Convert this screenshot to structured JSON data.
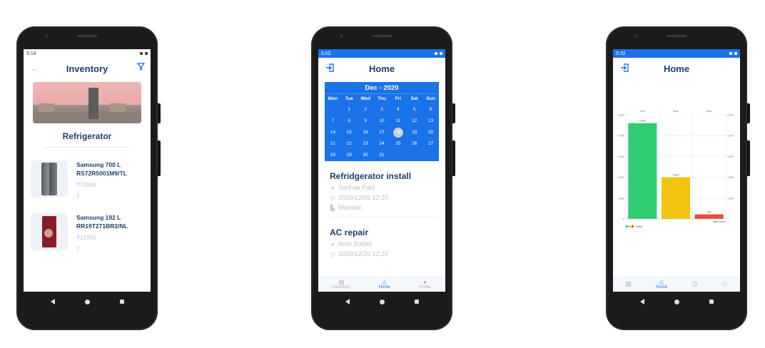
{
  "phones": [
    {
      "time": "9:18",
      "title": "Inventory",
      "category": "Refrigerator",
      "items": [
        {
          "name_line1": "Samsung 700 L",
          "name_line2": "RS72R5001M9/TL",
          "price": "₹74990",
          "qty": "1"
        },
        {
          "name_line1": "Samsung 192 L",
          "name_line2": "RR19T271BR2/NL",
          "price": "₹12990",
          "qty": "1"
        }
      ]
    },
    {
      "time": "5:02",
      "title": "Home",
      "calendar": {
        "month": "Dec - 2020",
        "weekdays": [
          "Mon",
          "Tue",
          "Wed",
          "Thu",
          "Fri",
          "Sat",
          "Sun"
        ],
        "today": "18",
        "event_day": "5"
      },
      "events": [
        {
          "title": "Refridgerator install",
          "person": "Sarthak Patil",
          "datetime": "2020/12/05 12:20",
          "city": "Mumbai"
        },
        {
          "title": "AC repair",
          "person": "Aren Buttler",
          "datetime": "2020/12/20 12:20"
        }
      ],
      "tabs": [
        {
          "label": "Inventory",
          "icon": "inventory-icon"
        },
        {
          "label": "Home",
          "icon": "home-icon"
        },
        {
          "label": "Profile",
          "icon": "profile-icon"
        }
      ]
    },
    {
      "time": "9:32",
      "title": "Home",
      "tabs": [
        {
          "label": "",
          "icon": "inventory-icon"
        },
        {
          "label": "Home",
          "icon": "home-icon"
        },
        {
          "label": "",
          "icon": "clock-icon"
        },
        {
          "label": "",
          "icon": "people-icon"
        }
      ]
    }
  ],
  "chart_data": {
    "type": "bar",
    "categories": [
      "Oct",
      "Nov",
      "Dec"
    ],
    "series": [
      {
        "name": "Sales",
        "values": [
          4600,
          2000,
          220
        ]
      }
    ],
    "data_labels": [
      "4,600",
      "2,000",
      "220"
    ],
    "ylim": [
      0,
      5000
    ],
    "yticks": [
      "0",
      "1,000",
      "2,000",
      "3,000",
      "4,000",
      "5,000"
    ],
    "bar_colors": [
      "#2ecc71",
      "#f1c40f",
      "#e74c3c"
    ],
    "legend": "bottom-left",
    "annotation": "Sales Report",
    "grid": true
  },
  "colors": {
    "accent": "#1a73e8",
    "title": "#1d3f6b"
  }
}
